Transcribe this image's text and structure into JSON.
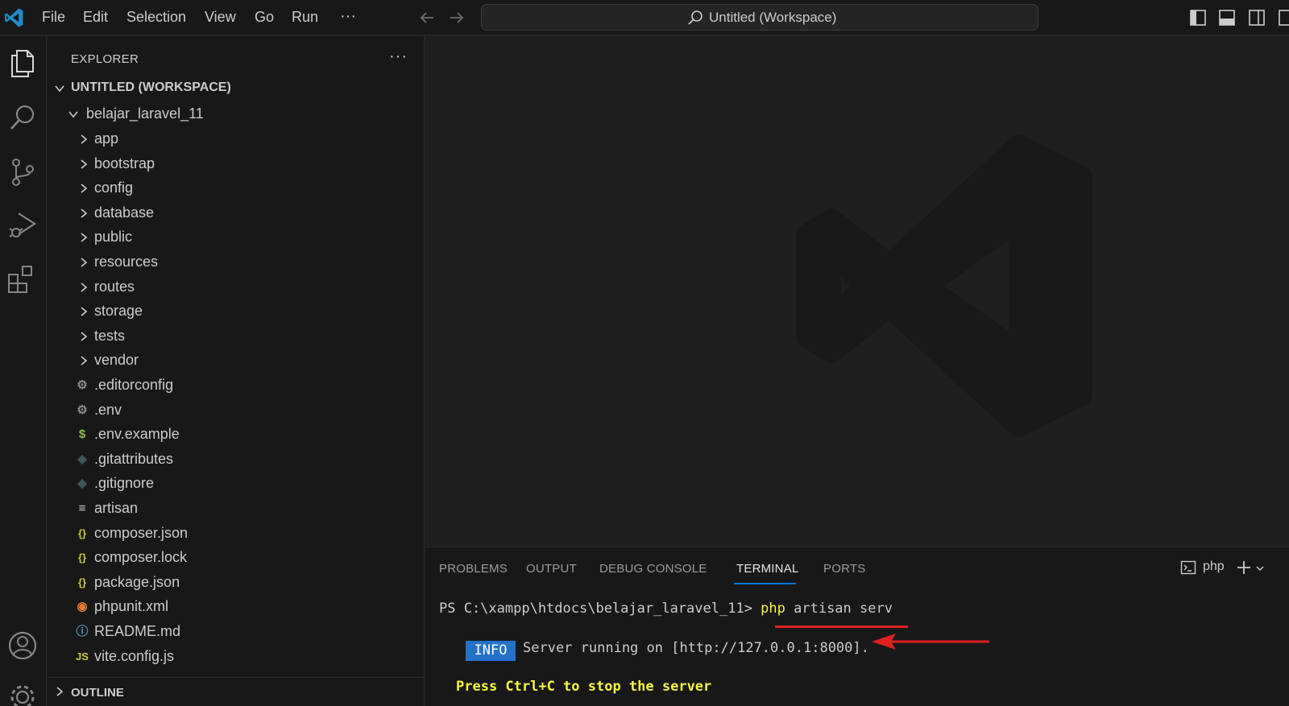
{
  "menu": {
    "items": [
      "File",
      "Edit",
      "Selection",
      "View",
      "Go",
      "Run"
    ],
    "more": "···"
  },
  "search": {
    "text": "Untitled (Workspace)"
  },
  "explorer": {
    "title": "EXPLORER",
    "more": "···",
    "workspace_label": "UNTITLED (WORKSPACE)",
    "project_folder": "belajar_laravel_11",
    "folders": [
      "app",
      "bootstrap",
      "config",
      "database",
      "public",
      "resources",
      "routes",
      "storage",
      "tests",
      "vendor"
    ],
    "files": [
      {
        "name": ".editorconfig",
        "icon": "gear-icon",
        "color": "#8a8a8a"
      },
      {
        "name": ".env",
        "icon": "gear-icon",
        "color": "#8a8a8a"
      },
      {
        "name": ".env.example",
        "icon": "dollar-icon",
        "color": "#8dc149"
      },
      {
        "name": ".gitattributes",
        "icon": "git-icon",
        "color": "#41535b"
      },
      {
        "name": ".gitignore",
        "icon": "git-icon",
        "color": "#41535b"
      },
      {
        "name": "artisan",
        "icon": "lines-icon",
        "color": "#cccccc"
      },
      {
        "name": "composer.json",
        "icon": "braces-icon",
        "color": "#cbcb41"
      },
      {
        "name": "composer.lock",
        "icon": "braces-icon",
        "color": "#cbcb41"
      },
      {
        "name": "package.json",
        "icon": "braces-icon",
        "color": "#cbcb41"
      },
      {
        "name": "phpunit.xml",
        "icon": "rss-icon",
        "color": "#e37933"
      },
      {
        "name": "README.md",
        "icon": "info-icon",
        "color": "#519aba"
      },
      {
        "name": "vite.config.js",
        "icon": "js-icon",
        "color": "#cbcb41"
      }
    ],
    "outline_label": "OUTLINE"
  },
  "panel": {
    "tabs": [
      "PROBLEMS",
      "OUTPUT",
      "DEBUG CONSOLE",
      "TERMINAL",
      "PORTS"
    ],
    "active_tab": "TERMINAL",
    "terminal_name": "php"
  },
  "terminal": {
    "prompt": "PS C:\\xampp\\htdocs\\belajar_laravel_11> ",
    "cmd_php": "php",
    "cmd_rest": " artisan serv",
    "info_badge": "INFO",
    "info_text": "Server running on [http://127.0.0.1:8000].",
    "stop_text": "Press Ctrl+C to stop the server"
  },
  "colors": {
    "accent": "#0078d4",
    "annotation_red": "#e02020",
    "terminal_yellow": "#f5f543",
    "info_blue": "#2472c8"
  }
}
